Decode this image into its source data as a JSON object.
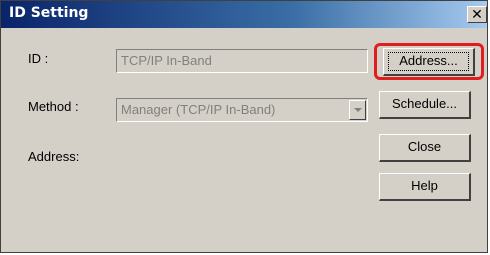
{
  "window": {
    "title": "ID Setting",
    "close_glyph": "✕"
  },
  "form": {
    "id_label": "ID :",
    "id_value": "TCP/IP In-Band",
    "method_label": "Method :",
    "method_value": "Manager (TCP/IP In-Band)",
    "address_label": "Address:"
  },
  "buttons": {
    "address": "Address...",
    "schedule": "Schedule...",
    "close": "Close",
    "help": "Help"
  },
  "colors": {
    "highlight": "#e01e1e"
  }
}
